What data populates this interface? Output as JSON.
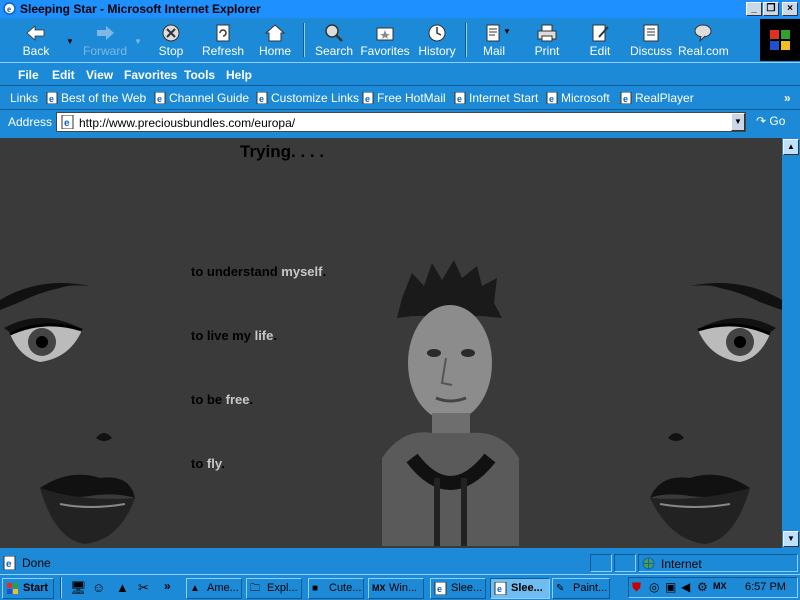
{
  "window": {
    "title": "Sleeping Star - Microsoft Internet Explorer"
  },
  "toolbar": {
    "back": "Back",
    "forward": "Forward",
    "stop": "Stop",
    "refresh": "Refresh",
    "home": "Home",
    "search": "Search",
    "favorites": "Favorites",
    "history": "History",
    "mail": "Mail",
    "print": "Print",
    "edit": "Edit",
    "discuss": "Discuss",
    "real": "Real.com"
  },
  "menu": {
    "file": "File",
    "edit": "Edit",
    "view": "View",
    "favorites": "Favorites",
    "tools": "Tools",
    "help": "Help"
  },
  "links": {
    "label": "Links",
    "items": [
      "Best of the Web",
      "Channel Guide",
      "Customize Links",
      "Free HotMail",
      "Internet Start",
      "Microsoft",
      "RealPlayer"
    ]
  },
  "address": {
    "label": "Address",
    "url": "http://www.preciousbundles.com/europa/",
    "go": "Go"
  },
  "page": {
    "heading": "Trying. . . .",
    "lines": [
      {
        "pre": "to understand ",
        "hi": "myself",
        "post": "."
      },
      {
        "pre": "to live my ",
        "hi": "life",
        "post": "."
      },
      {
        "pre": "to be ",
        "hi": "free",
        "post": "."
      },
      {
        "pre": "to ",
        "hi": "fly",
        "post": "."
      }
    ]
  },
  "status": {
    "text": "Done",
    "zone": "Internet"
  },
  "taskbar": {
    "start": "Start",
    "buttons": [
      "Ame...",
      "Expl...",
      "Cute...",
      "Win...",
      "Slee...",
      "Slee...",
      "Paint..."
    ],
    "clock": "6:57 PM"
  },
  "colors": {
    "chrome": "#1c8ad6",
    "page_bg": "#3a3a3a",
    "highlight_text": "#c8c8c8"
  }
}
